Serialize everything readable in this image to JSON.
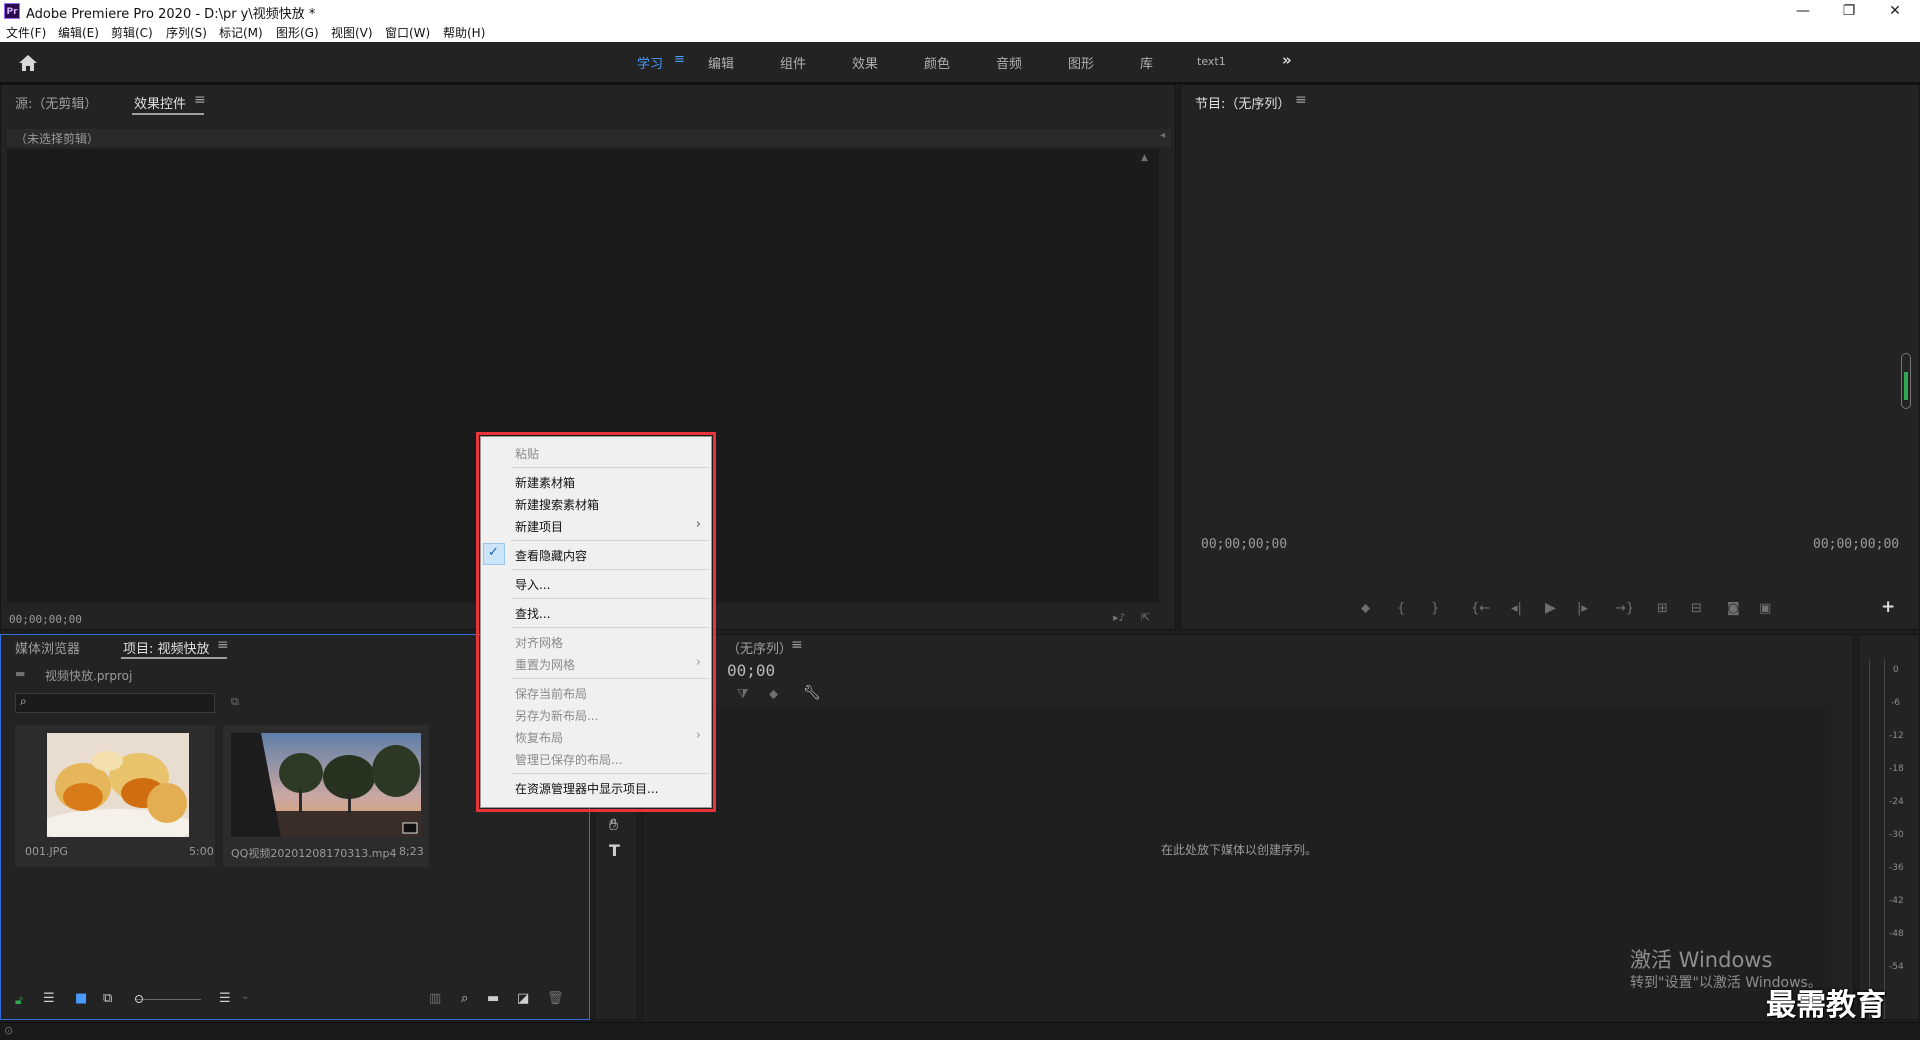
{
  "window": {
    "app_icon_text": "Pr",
    "title": "Adobe Premiere Pro 2020 - D:\\pr y\\视频快放 *",
    "minimize": "—",
    "maximize": "❐",
    "close": "✕"
  },
  "menubar": [
    "文件(F)",
    "编辑(E)",
    "剪辑(C)",
    "序列(S)",
    "标记(M)",
    "图形(G)",
    "视图(V)",
    "窗口(W)",
    "帮助(H)"
  ],
  "workspaces": {
    "tabs": [
      "学习",
      "编辑",
      "组件",
      "效果",
      "颜色",
      "音频",
      "图形",
      "库",
      "text1"
    ],
    "active_index": 0,
    "more": "»"
  },
  "source_panel": {
    "tab_source": "源:（无剪辑）",
    "tab_effects": "效果控件",
    "no_clip": "（未选择剪辑）",
    "timecode": "00;00;00;00"
  },
  "program_panel": {
    "title": "节目:（无序列）",
    "timecode_left": "00;00;00;00",
    "timecode_right": "00;00;00;00"
  },
  "project_panel": {
    "tab_media_browser": "媒体浏览器",
    "tab_project": "项目: 视频快放",
    "project_file": "视频快放.prproj",
    "search_placeholder": "",
    "items": [
      {
        "name": "001.JPG",
        "duration": "5:00"
      },
      {
        "name": "QQ视频20201208170313.mp4",
        "duration": "8;23"
      }
    ]
  },
  "timeline_panel": {
    "title": "（无序列）",
    "timecode": "00;00",
    "drop_hint": "在此处放下媒体以创建序列。"
  },
  "audio_meter": {
    "ticks": [
      "0",
      "-6",
      "-12",
      "-18",
      "-24",
      "-30",
      "-36",
      "-42",
      "-48",
      "-54"
    ]
  },
  "context_menu": {
    "items": [
      {
        "label": "粘贴",
        "enabled": false
      },
      {
        "label": "新建素材箱",
        "enabled": true
      },
      {
        "label": "新建搜索素材箱",
        "enabled": true
      },
      {
        "label": "新建项目",
        "enabled": true,
        "submenu": true
      },
      {
        "label": "查看隐藏内容",
        "enabled": true,
        "checked": true
      },
      {
        "label": "导入...",
        "enabled": true
      },
      {
        "label": "查找...",
        "enabled": true
      },
      {
        "label": "对齐网格",
        "enabled": false
      },
      {
        "label": "重置为网格",
        "enabled": false,
        "submenu": true
      },
      {
        "label": "保存当前布局",
        "enabled": false
      },
      {
        "label": "另存为新布局...",
        "enabled": false
      },
      {
        "label": "恢复布局",
        "enabled": false,
        "submenu": true
      },
      {
        "label": "管理已保存的布局...",
        "enabled": false
      },
      {
        "label": "在资源管理器中显示项目...",
        "enabled": true
      }
    ],
    "highlight_color": "#e8353b"
  },
  "watermark": {
    "line1": "激活 Windows",
    "line2": "转到\"设置\"以激活 Windows。",
    "logo": "最需教育"
  },
  "colors": {
    "accent": "#4a9bff",
    "panel_bg": "#232323",
    "app_bg": "#1d1d1d"
  }
}
